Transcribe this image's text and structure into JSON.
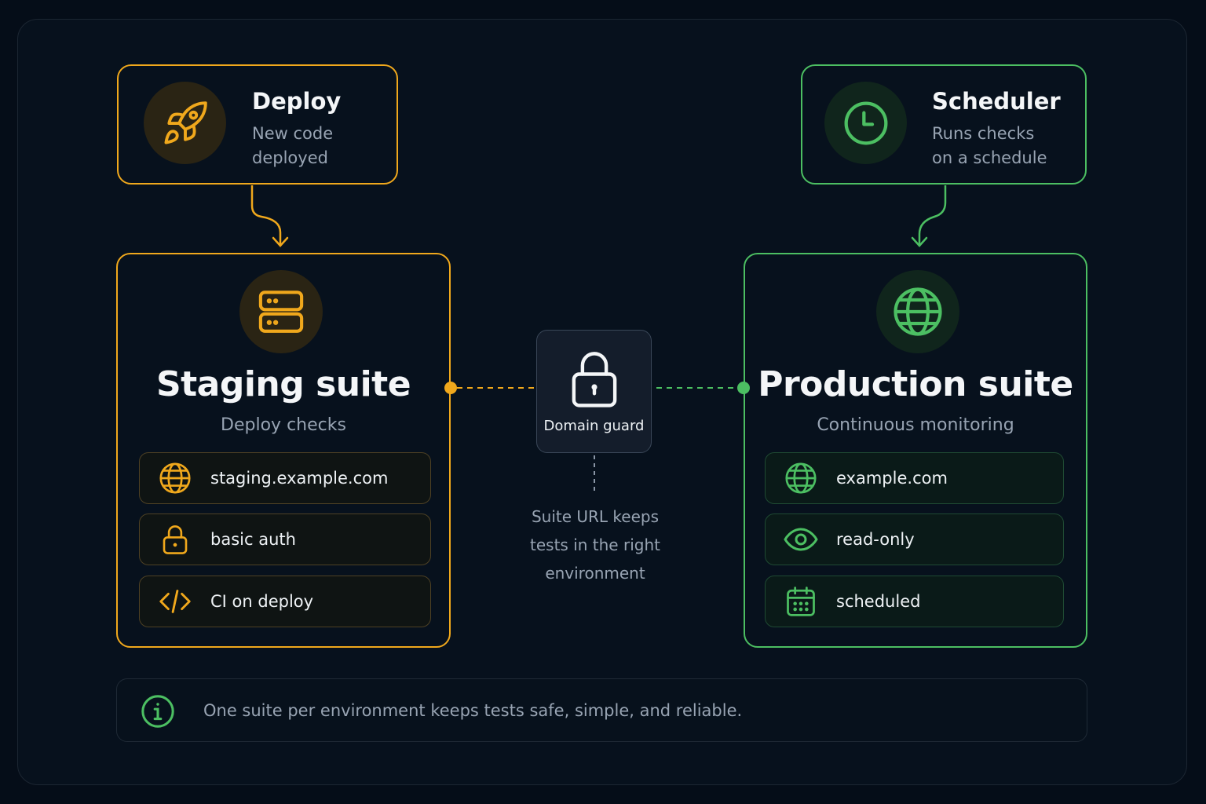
{
  "triggers": {
    "deploy": {
      "title": "Deploy",
      "line1": "New code",
      "line2": "deployed"
    },
    "scheduler": {
      "title": "Scheduler",
      "line1": "Runs checks",
      "line2": "on a schedule"
    }
  },
  "staging": {
    "title": "Staging suite",
    "subtitle": "Deploy checks",
    "items": [
      {
        "icon": "globe-icon",
        "label": "staging.example.com"
      },
      {
        "icon": "lock-icon",
        "label": "basic auth"
      },
      {
        "icon": "code-icon",
        "label": "CI on deploy"
      }
    ]
  },
  "production": {
    "title": "Production suite",
    "subtitle": "Continuous monitoring",
    "items": [
      {
        "icon": "globe-icon",
        "label": "example.com"
      },
      {
        "icon": "eye-icon",
        "label": "read-only"
      },
      {
        "icon": "calendar-icon",
        "label": "scheduled"
      }
    ]
  },
  "guard": {
    "label": "Domain guard",
    "note_lines": [
      "Suite URL keeps",
      "tests in the right",
      "environment"
    ]
  },
  "info": {
    "text": "One suite per environment keeps tests safe, simple, and reliable."
  },
  "colors": {
    "staging": "#f0a81c",
    "production": "#4cbf62",
    "background": "#07111d"
  }
}
